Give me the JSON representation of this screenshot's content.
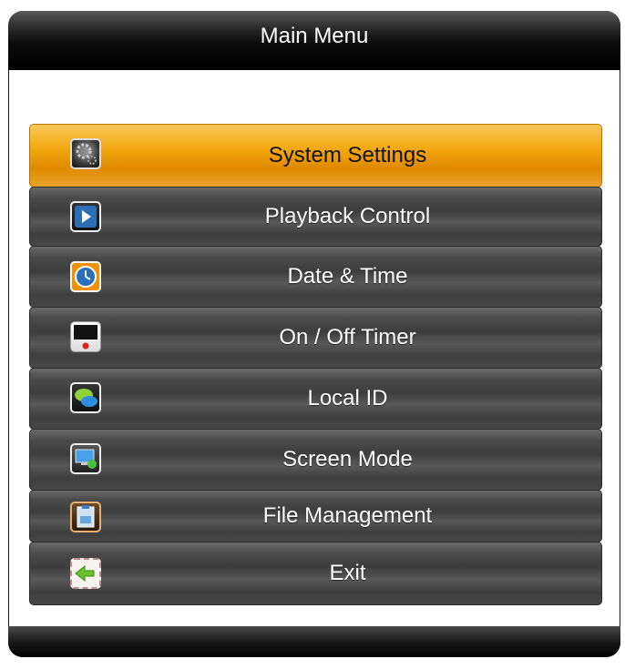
{
  "header": {
    "title": "Main Menu"
  },
  "menu": {
    "items": [
      {
        "label": "System Settings",
        "icon": "gear-icon",
        "selected": true
      },
      {
        "label": "Playback Control",
        "icon": "play-icon",
        "selected": false
      },
      {
        "label": "Date & Time",
        "icon": "clock-icon",
        "selected": false
      },
      {
        "label": "On / Off Timer",
        "icon": "power-timer-icon",
        "selected": false
      },
      {
        "label": "Local ID",
        "icon": "chat-bubbles-icon",
        "selected": false
      },
      {
        "label": "Screen Mode",
        "icon": "monitor-refresh-icon",
        "selected": false
      },
      {
        "label": "File Management",
        "icon": "file-icon",
        "selected": false
      },
      {
        "label": "Exit",
        "icon": "back-arrow-icon",
        "selected": false
      }
    ]
  },
  "colors": {
    "selected": "#f2a70e",
    "item": "#4a4a4a",
    "header": "#000000"
  }
}
